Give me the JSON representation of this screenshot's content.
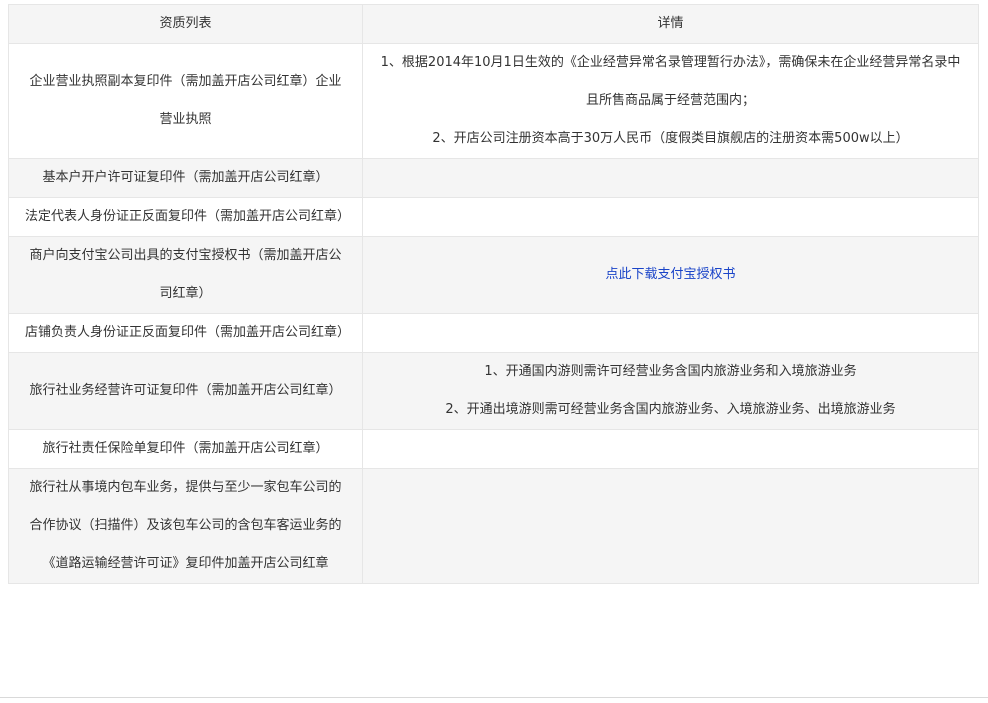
{
  "table": {
    "headers": [
      "资质列表",
      "详情"
    ],
    "rows": [
      {
        "requirement": "企业营业执照副本复印件（需加盖开店公司红章）企业营业执照",
        "details": [
          "1、根据2014年10月1日生效的《企业经营异常名录管理暂行办法》，需确保未在企业经营异常名录中且所售商品属于经营范围内；",
          "2、开店公司注册资本高于30万人民币（度假类目旗舰店的注册资本需500w以上）"
        ]
      },
      {
        "requirement": "基本户开户许可证复印件（需加盖开店公司红章）",
        "details": []
      },
      {
        "requirement": "法定代表人身份证正反面复印件（需加盖开店公司红章）",
        "details": []
      },
      {
        "requirement": "商户向支付宝公司出具的支付宝授权书（需加盖开店公司红章）",
        "link": "点此下载支付宝授权书"
      },
      {
        "requirement": "店铺负责人身份证正反面复印件（需加盖开店公司红章）",
        "details": []
      },
      {
        "requirement": "旅行社业务经营许可证复印件（需加盖开店公司红章）",
        "details": [
          "1、开通国内游则需许可经营业务含国内旅游业务和入境旅游业务",
          "2、开通出境游则需可经营业务含国内旅游业务、入境旅游业务、出境旅游业务"
        ]
      },
      {
        "requirement": "旅行社责任保险单复印件（需加盖开店公司红章）",
        "details": []
      },
      {
        "requirement": "旅行社从事境内包车业务，提供与至少一家包车公司的合作协议（扫描件）及该包车公司的含包车客运业务的《道路运输经营许可证》复印件加盖开店公司红章",
        "details": []
      }
    ]
  },
  "colors": {
    "header_bg": "#f5f5f5",
    "stripe_bg": "#f5f5f5",
    "border": "#e6e6e6",
    "text": "#333333",
    "link": "#1a44c8"
  }
}
